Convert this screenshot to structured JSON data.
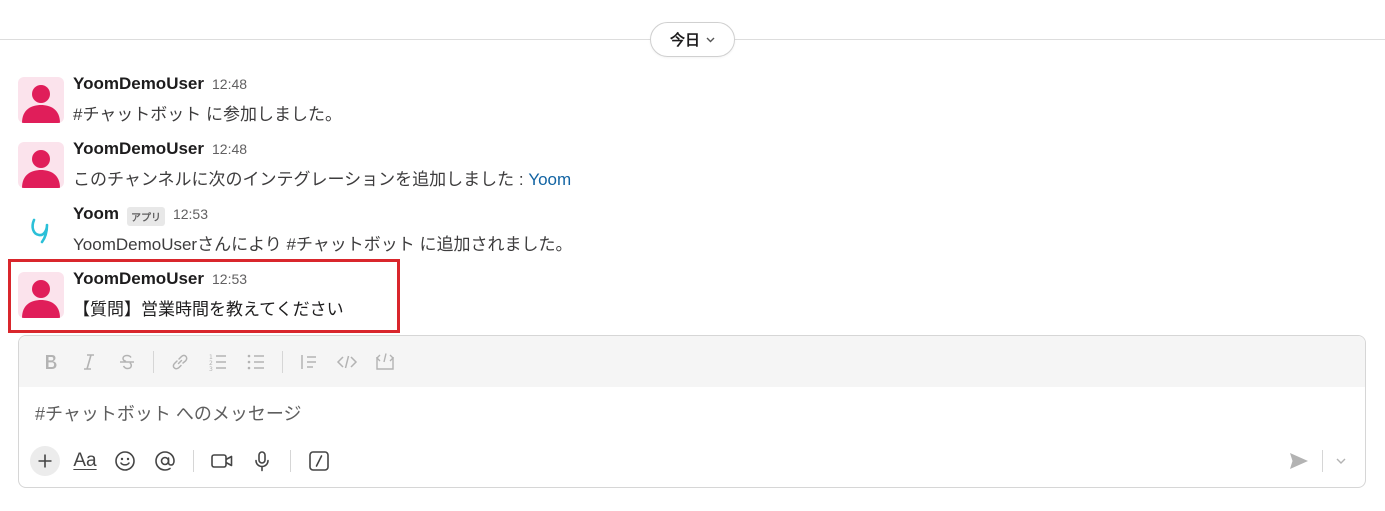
{
  "day_divider": {
    "label": "今日",
    "icon": "chevron-down-icon"
  },
  "messages": [
    {
      "author": "YoomDemoUser",
      "time": "12:48",
      "text": "#チャットボット に参加しました。",
      "avatar": "user-avatar"
    },
    {
      "author": "YoomDemoUser",
      "time": "12:48",
      "text": "このチャンネルに次のインテグレーションを追加しました : ",
      "link": "Yoom",
      "avatar": "user-avatar"
    },
    {
      "author": "Yoom",
      "badge": "アプリ",
      "time": "12:53",
      "text": "YoomDemoUserさんにより #チャットボット に追加されました。",
      "avatar": "yoom-logo"
    },
    {
      "author": "YoomDemoUser",
      "time": "12:53",
      "text": "【質問】営業時間を教えてください",
      "avatar": "user-avatar",
      "highlighted": true
    }
  ],
  "composer": {
    "placeholder": "#チャットボット へのメッセージ",
    "format_toolbar": [
      "bold-icon",
      "italic-icon",
      "strikethrough-icon",
      "link-icon",
      "ordered-list-icon",
      "bulleted-list-icon",
      "blockquote-icon",
      "code-icon",
      "code-block-icon"
    ],
    "bottom_toolbar": {
      "text_format_label": "Aa",
      "icons": [
        "plus-icon",
        "emoji-icon",
        "mention-icon",
        "video-icon",
        "microphone-icon",
        "slash-command-icon",
        "send-icon",
        "chevron-down-icon"
      ]
    }
  },
  "colors": {
    "highlight_border": "#d9262c",
    "link": "#1264a3",
    "avatar_pink": "#e01e5a",
    "yoom_teal": "#2bc0d8"
  }
}
